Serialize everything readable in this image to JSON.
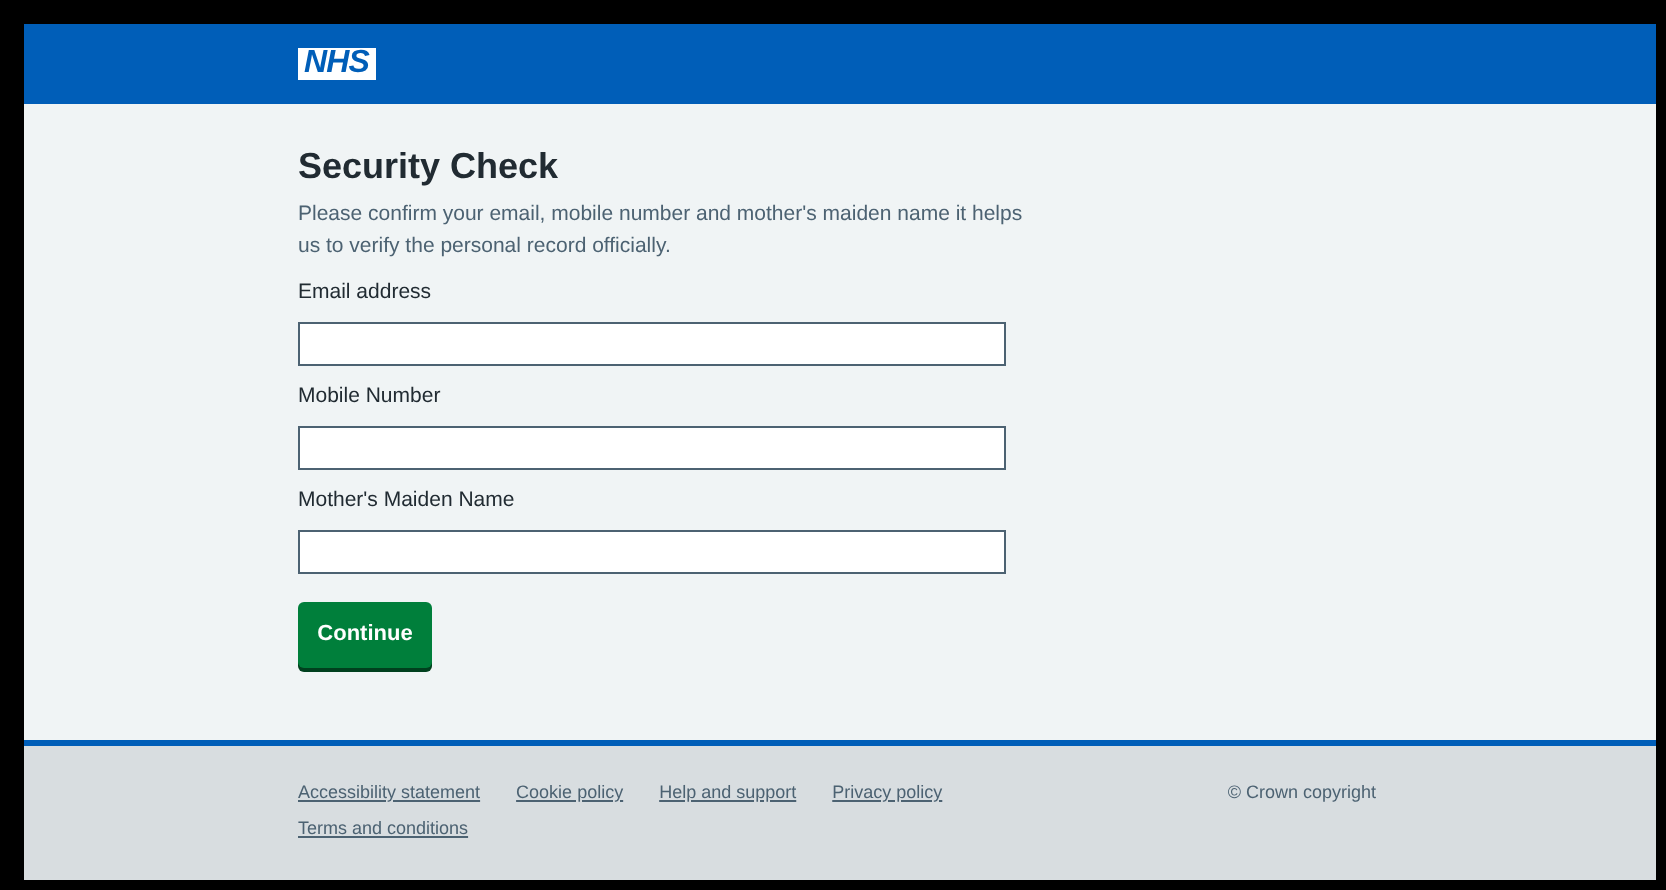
{
  "header": {
    "logo": "NHS"
  },
  "form": {
    "title": "Security Check",
    "intro": "Please confirm your email, mobile number and mother's maiden name it helps us to verify the personal record officially.",
    "fields": [
      {
        "label": "Email address"
      },
      {
        "label": "Mobile Number"
      },
      {
        "label": "Mother's Maiden Name"
      }
    ],
    "button": "Continue"
  },
  "footer": {
    "links": [
      "Accessibility statement",
      "Cookie policy",
      "Help and support",
      "Privacy policy",
      "Terms and conditions"
    ],
    "copyright": "© Crown copyright"
  }
}
